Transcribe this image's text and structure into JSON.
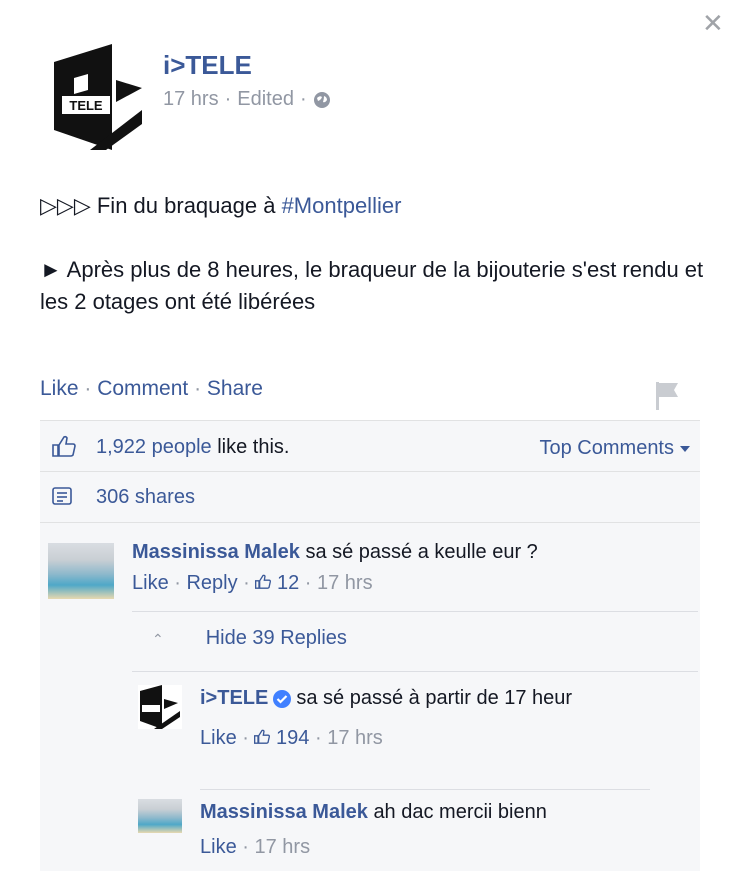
{
  "post": {
    "page_name": "i>TELE",
    "time": "17 hrs",
    "edited": "Edited",
    "dot": "·",
    "logo_text": "TELE",
    "line1_prefix": "▷▷▷ Fin du braquage à ",
    "hashtag": "#Montpellier",
    "line2": "► Après plus de 8 heures, le braqueur de la bijouterie s'est rendu et les 2 otages ont été libérées"
  },
  "actions": {
    "like": "Like",
    "comment": "Comment",
    "share": "Share",
    "sep": " · "
  },
  "ufi": {
    "likes_count": "1,922 people",
    "likes_suffix": " like this.",
    "top_comments": "Top Comments",
    "shares": "306 shares"
  },
  "comments": [
    {
      "author": "Massinissa Malek",
      "text": "sa sé passé a keulle eur ?",
      "like": "Like",
      "reply": "Reply",
      "likes": "12",
      "time": "17 hrs"
    }
  ],
  "hide_replies": "Hide 39 Replies",
  "replies": [
    {
      "author": "i>TELE",
      "text": "sa sé passé à partir de 17 heur",
      "like": "Like",
      "likes": "194",
      "time": "17 hrs"
    },
    {
      "author": "Massinissa Malek",
      "text": "ah dac mercii bienn",
      "like": "Like",
      "time": "17 hrs"
    }
  ],
  "colors": {
    "link": "#3b5998",
    "meta": "#9197a3",
    "ufi_bg": "#f6f7f9",
    "verified": "#4080ff"
  }
}
